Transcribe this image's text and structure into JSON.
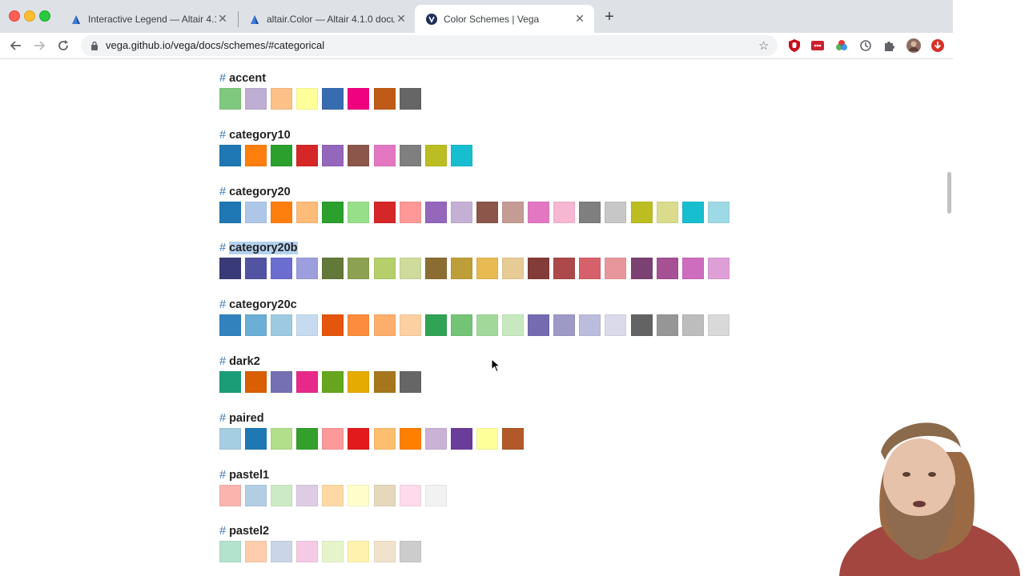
{
  "browser": {
    "tabs": [
      {
        "title": "Interactive Legend — Altair 4.1",
        "favicon": "altair-icon",
        "active": false
      },
      {
        "title": "altair.Color — Altair 4.1.0 docu",
        "favicon": "altair-icon",
        "active": false
      },
      {
        "title": "Color Schemes | Vega",
        "favicon": "vega-icon",
        "active": true
      }
    ],
    "url": "vega.github.io/vega/docs/schemes/#categorical"
  },
  "schemes": [
    {
      "name": "accent",
      "highlighted": false,
      "colors": [
        "#7fc97f",
        "#beaed4",
        "#fdc086",
        "#ffff99",
        "#386cb0",
        "#f0027f",
        "#bf5b17",
        "#666666"
      ]
    },
    {
      "name": "category10",
      "highlighted": false,
      "colors": [
        "#1f77b4",
        "#ff7f0e",
        "#2ca02c",
        "#d62728",
        "#9467bd",
        "#8c564b",
        "#e377c2",
        "#7f7f7f",
        "#bcbd22",
        "#17becf"
      ]
    },
    {
      "name": "category20",
      "highlighted": false,
      "colors": [
        "#1f77b4",
        "#aec7e8",
        "#ff7f0e",
        "#ffbb78",
        "#2ca02c",
        "#98df8a",
        "#d62728",
        "#ff9896",
        "#9467bd",
        "#c5b0d5",
        "#8c564b",
        "#c49c94",
        "#e377c2",
        "#f7b6d2",
        "#7f7f7f",
        "#c7c7c7",
        "#bcbd22",
        "#dbdb8d",
        "#17becf",
        "#9edae5"
      ]
    },
    {
      "name": "category20b",
      "highlighted": true,
      "colors": [
        "#393b79",
        "#5254a3",
        "#6b6ecf",
        "#9c9ede",
        "#637939",
        "#8ca252",
        "#b5cf6b",
        "#cedb9c",
        "#8c6d31",
        "#bd9e39",
        "#e7ba52",
        "#e7cb94",
        "#843c39",
        "#ad494a",
        "#d6616b",
        "#e7969c",
        "#7b4173",
        "#a55194",
        "#ce6dbd",
        "#de9ed6"
      ]
    },
    {
      "name": "category20c",
      "highlighted": false,
      "colors": [
        "#3182bd",
        "#6baed6",
        "#9ecae1",
        "#c6dbef",
        "#e6550d",
        "#fd8d3c",
        "#fdae6b",
        "#fdd0a2",
        "#31a354",
        "#74c476",
        "#a1d99b",
        "#c7e9c0",
        "#756bb1",
        "#9e9ac8",
        "#bcbddc",
        "#dadaeb",
        "#636363",
        "#969696",
        "#bdbdbd",
        "#d9d9d9"
      ]
    },
    {
      "name": "dark2",
      "highlighted": false,
      "colors": [
        "#1b9e77",
        "#d95f02",
        "#7570b3",
        "#e7298a",
        "#66a61e",
        "#e6ab02",
        "#a6761d",
        "#666666"
      ]
    },
    {
      "name": "paired",
      "highlighted": false,
      "colors": [
        "#a6cee3",
        "#1f78b4",
        "#b2df8a",
        "#33a02c",
        "#fb9a99",
        "#e31a1c",
        "#fdbf6f",
        "#ff7f00",
        "#cab2d6",
        "#6a3d9a",
        "#ffff99",
        "#b15928"
      ]
    },
    {
      "name": "pastel1",
      "highlighted": false,
      "colors": [
        "#fbb4ae",
        "#b3cde3",
        "#ccebc5",
        "#decbe4",
        "#fed9a6",
        "#ffffcc",
        "#e5d8bd",
        "#fddaec",
        "#f2f2f2"
      ]
    },
    {
      "name": "pastel2",
      "highlighted": false,
      "colors": [
        "#b3e2cd",
        "#fdcdac",
        "#cbd5e8",
        "#f4cae4",
        "#e6f5c9",
        "#fff2ae",
        "#f1e2cc",
        "#cccccc"
      ]
    }
  ]
}
